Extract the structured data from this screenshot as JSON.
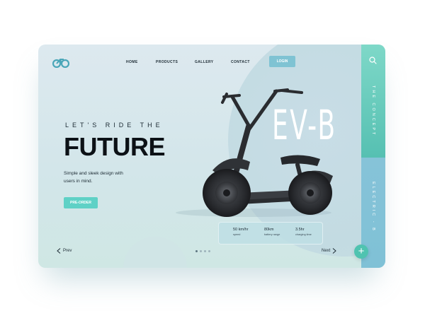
{
  "brand": {
    "logo": "bicycle-logo-icon"
  },
  "nav": {
    "items": [
      "HOME",
      "PRODUCTS",
      "GALLERY",
      "CONTACT"
    ],
    "login_label": "LOGIN"
  },
  "hero": {
    "eyebrow": "LET'S RIDE THE",
    "headline": "FUTURE",
    "subtitle": "Simple and sleek design with users in mind.",
    "cta_label": "PRE-ORDER",
    "model": "EV-B"
  },
  "specs": [
    {
      "value": "50 km/hr",
      "label": "speed"
    },
    {
      "value": "80km",
      "label": "battery range"
    },
    {
      "value": "3.5hr",
      "label": "charging time"
    }
  ],
  "pager": {
    "prev_label": "Prev",
    "next_label": "Next",
    "page_count": 4,
    "active_index": 0
  },
  "side_rail": {
    "top_text": "THE CONCEPT",
    "bottom_text": "ELECTRIC - B",
    "search_icon": "search-icon",
    "fab_icon": "plus-icon"
  },
  "colors": {
    "accent_teal": "#5fd1c6",
    "accent_blue": "#7fc3d3",
    "text_dark": "#0c1116"
  }
}
